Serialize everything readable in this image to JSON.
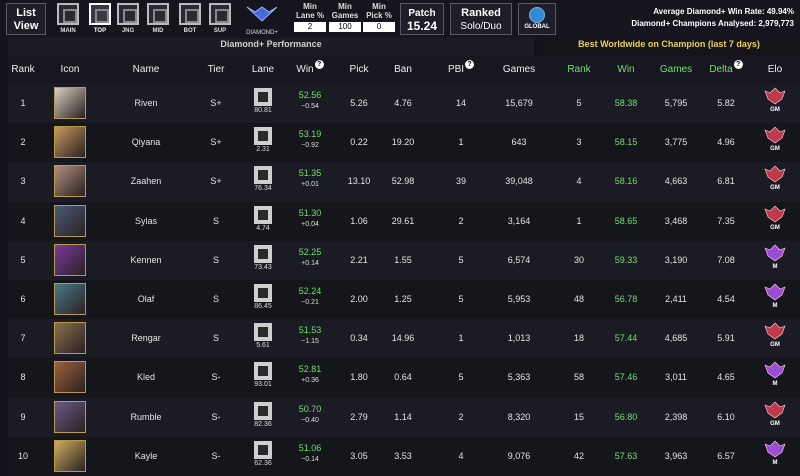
{
  "toolbar": {
    "list_view_line1": "List",
    "list_view_line2": "View",
    "roles": [
      {
        "label": "MAIN",
        "active": false
      },
      {
        "label": "TOP",
        "active": true
      },
      {
        "label": "JNG",
        "active": false
      },
      {
        "label": "MID",
        "active": false
      },
      {
        "label": "BOT",
        "active": false
      },
      {
        "label": "SUP",
        "active": false
      }
    ],
    "rank_filter_label": "DIAMOND+",
    "filters": [
      {
        "line1": "Min",
        "line2": "Lane %",
        "value": "2"
      },
      {
        "line1": "Min",
        "line2": "Games",
        "value": "100"
      },
      {
        "line1": "Min",
        "line2": "Pick %",
        "value": "0"
      }
    ],
    "patch_label": "Patch",
    "patch_value": "15.24",
    "queue_line1": "Ranked",
    "queue_line2": "Solo/Duo",
    "region_label": "GLOBAL",
    "avg_winrate": "Average Diamond+ Win Rate: 49.94%",
    "champions_analysed": "Diamond+ Champions Analysed: 2,979,773"
  },
  "sections": {
    "left": "Diamond+ Performance",
    "right": "Best Worldwide on Champion (last 7 days)"
  },
  "columns": [
    "Rank",
    "Icon",
    "Name",
    "Tier",
    "Lane",
    "Win",
    "Pick",
    "Ban",
    "PBI",
    "Games",
    "Rank",
    "Win",
    "Games",
    "Delta",
    "Elo"
  ],
  "colors": {
    "accent_green": "#6fe06a",
    "gm_badge": "#c0394b",
    "m_badge": "#9b4dd6",
    "section_right": "#e8d25a"
  },
  "rows": [
    {
      "rank": "1",
      "name": "Riven",
      "tier": "S+",
      "lane": "80.81",
      "win": "52.56",
      "win_delta": "−0.54",
      "pick": "5.26",
      "ban": "4.76",
      "pbi": "14",
      "games": "15,679",
      "best_rank": "5",
      "best_win": "58.38",
      "best_games": "5,795",
      "delta": "5.82",
      "elo": "GM",
      "icon_color": "#d8d0c0"
    },
    {
      "rank": "2",
      "name": "Qiyana",
      "tier": "S+",
      "lane": "2.31",
      "win": "53.19",
      "win_delta": "−0.92",
      "pick": "0.22",
      "ban": "19.20",
      "pbi": "1",
      "games": "643",
      "best_rank": "3",
      "best_win": "58.15",
      "best_games": "3,775",
      "delta": "4.96",
      "elo": "GM",
      "icon_color": "#c99a5c"
    },
    {
      "rank": "3",
      "name": "Zaahen",
      "tier": "S+",
      "lane": "76.34",
      "win": "51.35",
      "win_delta": "+0.01",
      "pick": "13.10",
      "ban": "52.98",
      "pbi": "39",
      "games": "39,048",
      "best_rank": "4",
      "best_win": "58.16",
      "best_games": "4,663",
      "delta": "6.81",
      "elo": "GM",
      "icon_color": "#b09080"
    },
    {
      "rank": "4",
      "name": "Sylas",
      "tier": "S",
      "lane": "4.74",
      "win": "51.30",
      "win_delta": "+0.04",
      "pick": "1.06",
      "ban": "29.61",
      "pbi": "2",
      "games": "3,164",
      "best_rank": "1",
      "best_win": "58.65",
      "best_games": "3,468",
      "delta": "7.35",
      "elo": "GM",
      "icon_color": "#4a5a7a"
    },
    {
      "rank": "5",
      "name": "Kennen",
      "tier": "S",
      "lane": "73.43",
      "win": "52.25",
      "win_delta": "+0.14",
      "pick": "2.21",
      "ban": "1.55",
      "pbi": "5",
      "games": "6,574",
      "best_rank": "30",
      "best_win": "59.33",
      "best_games": "3,190",
      "delta": "7.08",
      "elo": "M",
      "icon_color": "#7a3aa0"
    },
    {
      "rank": "6",
      "name": "Olaf",
      "tier": "S",
      "lane": "86.45",
      "win": "52.24",
      "win_delta": "−0.21",
      "pick": "2.00",
      "ban": "1.25",
      "pbi": "5",
      "games": "5,953",
      "best_rank": "48",
      "best_win": "56.78",
      "best_games": "2,411",
      "delta": "4.54",
      "elo": "M",
      "icon_color": "#4a7a8a"
    },
    {
      "rank": "7",
      "name": "Rengar",
      "tier": "S",
      "lane": "5.61",
      "win": "51.53",
      "win_delta": "−1.15",
      "pick": "0.34",
      "ban": "14.96",
      "pbi": "1",
      "games": "1,013",
      "best_rank": "18",
      "best_win": "57.44",
      "best_games": "4,685",
      "delta": "5.91",
      "elo": "GM",
      "icon_color": "#8a7050"
    },
    {
      "rank": "8",
      "name": "Kled",
      "tier": "S-",
      "lane": "93.01",
      "win": "52.81",
      "win_delta": "+0.36",
      "pick": "1.80",
      "ban": "0.64",
      "pbi": "5",
      "games": "5,363",
      "best_rank": "58",
      "best_win": "57.46",
      "best_games": "3,011",
      "delta": "4.65",
      "elo": "M",
      "icon_color": "#a06040"
    },
    {
      "rank": "9",
      "name": "Rumble",
      "tier": "S-",
      "lane": "82.36",
      "win": "50.70",
      "win_delta": "−0.40",
      "pick": "2.79",
      "ban": "1.14",
      "pbi": "2",
      "games": "8,320",
      "best_rank": "15",
      "best_win": "56.80",
      "best_games": "2,398",
      "delta": "6.10",
      "elo": "GM",
      "icon_color": "#6a5a8a"
    },
    {
      "rank": "10",
      "name": "Kayle",
      "tier": "S-",
      "lane": "62.36",
      "win": "51.06",
      "win_delta": "−0.14",
      "pick": "3.05",
      "ban": "3.53",
      "pbi": "4",
      "games": "9,076",
      "best_rank": "42",
      "best_win": "57.63",
      "best_games": "3,963",
      "delta": "6.57",
      "elo": "M",
      "icon_color": "#d0b060"
    }
  ]
}
